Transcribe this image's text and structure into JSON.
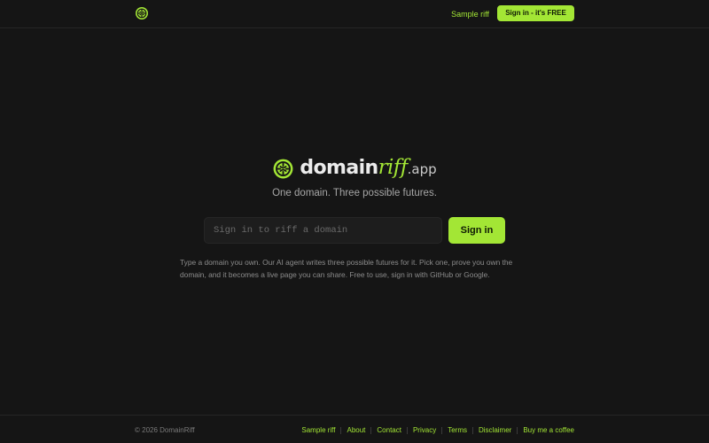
{
  "header": {
    "logo_icon": "globe-target-icon",
    "sample_link": "Sample riff",
    "cta_label": "Sign in - it's FREE"
  },
  "hero": {
    "brand_main": "domain",
    "brand_accent": "riff",
    "brand_suffix": ".app",
    "tagline": "One domain. Three possible futures.",
    "input_placeholder": "Sign in to riff a domain",
    "input_value": "",
    "signin_label": "Sign in",
    "description": "Type a domain you own. Our AI agent writes three possible futures for it. Pick one, prove you own the domain, and it becomes a live page you can share. Free to use, sign in with GitHub or Google."
  },
  "footer": {
    "copyright": "© 2026 DomainRiff",
    "links": [
      "Sample riff",
      "About",
      "Contact",
      "Privacy",
      "Terms",
      "Disclaimer",
      "Buy me a coffee"
    ]
  },
  "colors": {
    "background": "#151515",
    "accent": "#a3e635",
    "border": "#262626"
  }
}
